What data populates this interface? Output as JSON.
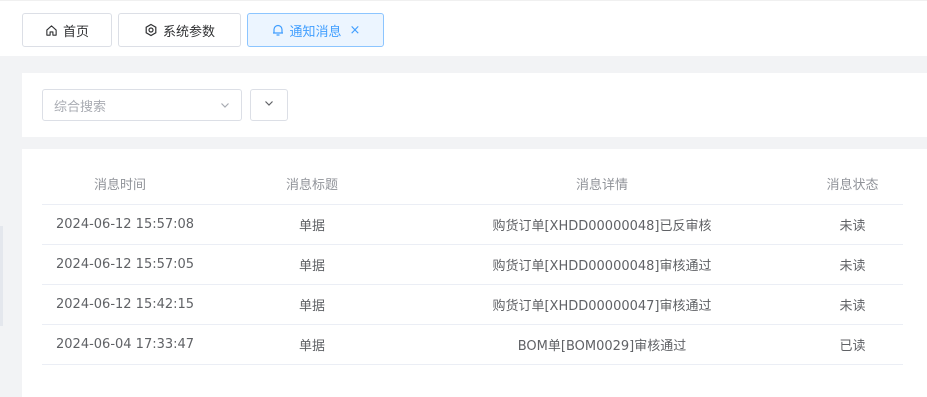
{
  "tabs": [
    {
      "label": "首页",
      "icon": "home-icon"
    },
    {
      "label": "系统参数",
      "icon": "settings-icon"
    },
    {
      "label": "通知消息",
      "icon": "bell-icon",
      "active": true
    }
  ],
  "search": {
    "placeholder": "综合搜索"
  },
  "table": {
    "headers": [
      "消息时间",
      "消息标题",
      "消息详情",
      "消息状态"
    ],
    "rows": [
      {
        "time": "2024-06-12 15:57:08",
        "title": "单据",
        "detail": "购货订单[XHDD00000048]已反审核",
        "status": "未读"
      },
      {
        "time": "2024-06-12 15:57:05",
        "title": "单据",
        "detail": "购货订单[XHDD00000048]审核通过",
        "status": "未读"
      },
      {
        "time": "2024-06-12 15:42:15",
        "title": "单据",
        "detail": "购货订单[XHDD00000047]审核通过",
        "status": "未读"
      },
      {
        "time": "2024-06-04 17:33:47",
        "title": "单据",
        "detail": "BOM单[BOM0029]审核通过",
        "status": "已读"
      }
    ]
  },
  "colors": {
    "accent": "#409eff",
    "active_bg": "#ecf5ff",
    "page_bg": "#f2f3f5"
  }
}
